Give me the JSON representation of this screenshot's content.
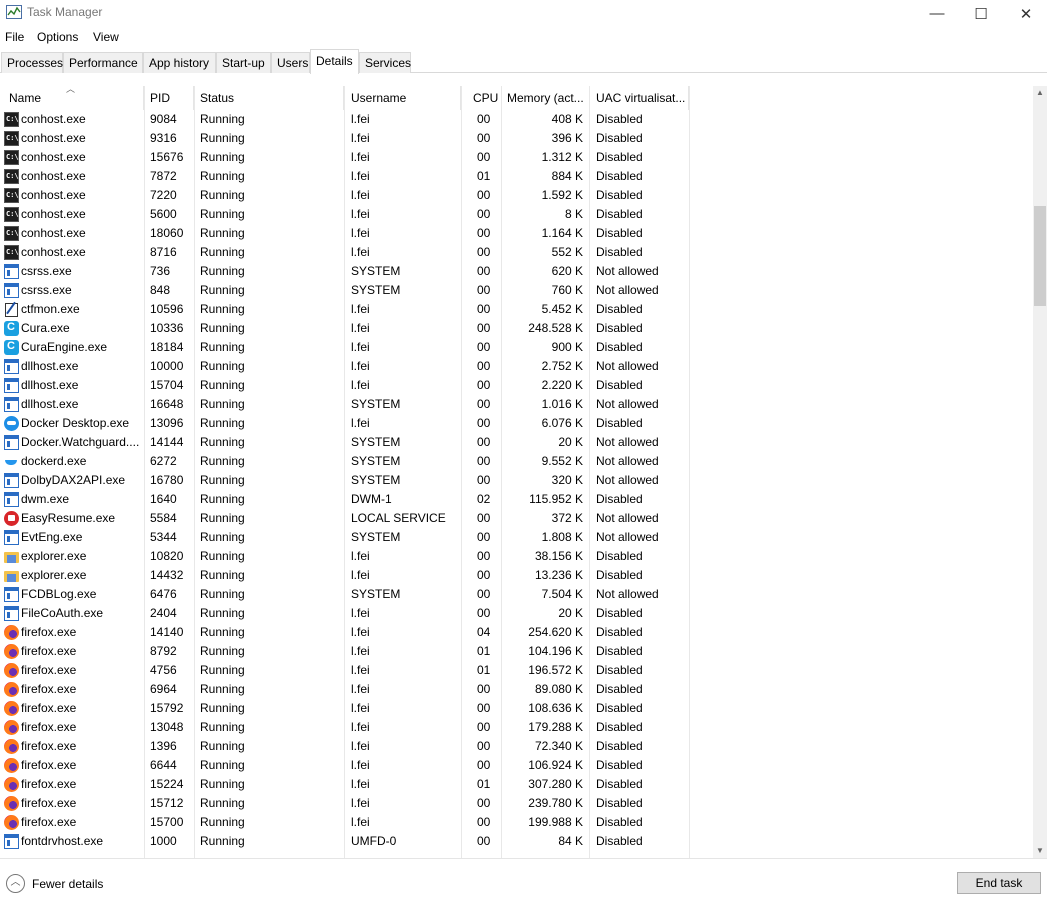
{
  "window": {
    "title": "Task Manager",
    "minimize_glyph": "—",
    "maximize_glyph": "☐",
    "close_glyph": "✕"
  },
  "menu": [
    "File",
    "Options",
    "View"
  ],
  "tabs": [
    {
      "label": "Processes",
      "active": false
    },
    {
      "label": "Performance",
      "active": false
    },
    {
      "label": "App history",
      "active": false
    },
    {
      "label": "Start-up",
      "active": false
    },
    {
      "label": "Users",
      "active": false
    },
    {
      "label": "Details",
      "active": true
    },
    {
      "label": "Services",
      "active": false
    }
  ],
  "columns": {
    "name": "Name",
    "pid": "PID",
    "status": "Status",
    "username": "Username",
    "cpu": "CPU",
    "memory": "Memory (act...",
    "uac": "UAC virtualisat..."
  },
  "rows": [
    {
      "name": "conhost.exe",
      "icon": "console-icon",
      "pid": "9084",
      "status": "Running",
      "user": "l.fei",
      "cpu": "00",
      "mem": "408 K",
      "uac": "Disabled"
    },
    {
      "name": "conhost.exe",
      "icon": "console-icon",
      "pid": "9316",
      "status": "Running",
      "user": "l.fei",
      "cpu": "00",
      "mem": "396 K",
      "uac": "Disabled"
    },
    {
      "name": "conhost.exe",
      "icon": "console-icon",
      "pid": "15676",
      "status": "Running",
      "user": "l.fei",
      "cpu": "00",
      "mem": "1.312 K",
      "uac": "Disabled"
    },
    {
      "name": "conhost.exe",
      "icon": "console-icon",
      "pid": "7872",
      "status": "Running",
      "user": "l.fei",
      "cpu": "01",
      "mem": "884 K",
      "uac": "Disabled"
    },
    {
      "name": "conhost.exe",
      "icon": "console-icon",
      "pid": "7220",
      "status": "Running",
      "user": "l.fei",
      "cpu": "00",
      "mem": "1.592 K",
      "uac": "Disabled"
    },
    {
      "name": "conhost.exe",
      "icon": "console-icon",
      "pid": "5600",
      "status": "Running",
      "user": "l.fei",
      "cpu": "00",
      "mem": "8 K",
      "uac": "Disabled"
    },
    {
      "name": "conhost.exe",
      "icon": "console-icon",
      "pid": "18060",
      "status": "Running",
      "user": "l.fei",
      "cpu": "00",
      "mem": "1.164 K",
      "uac": "Disabled"
    },
    {
      "name": "conhost.exe",
      "icon": "console-icon",
      "pid": "8716",
      "status": "Running",
      "user": "l.fei",
      "cpu": "00",
      "mem": "552 K",
      "uac": "Disabled"
    },
    {
      "name": "csrss.exe",
      "icon": "window-icon",
      "pid": "736",
      "status": "Running",
      "user": "SYSTEM",
      "cpu": "00",
      "mem": "620 K",
      "uac": "Not allowed"
    },
    {
      "name": "csrss.exe",
      "icon": "window-icon",
      "pid": "848",
      "status": "Running",
      "user": "SYSTEM",
      "cpu": "00",
      "mem": "760 K",
      "uac": "Not allowed"
    },
    {
      "name": "ctfmon.exe",
      "icon": "pen-icon",
      "pid": "10596",
      "status": "Running",
      "user": "l.fei",
      "cpu": "00",
      "mem": "5.452 K",
      "uac": "Disabled"
    },
    {
      "name": "Cura.exe",
      "icon": "cura-icon",
      "pid": "10336",
      "status": "Running",
      "user": "l.fei",
      "cpu": "00",
      "mem": "248.528 K",
      "uac": "Disabled"
    },
    {
      "name": "CuraEngine.exe",
      "icon": "cura-icon",
      "pid": "18184",
      "status": "Running",
      "user": "l.fei",
      "cpu": "00",
      "mem": "900 K",
      "uac": "Disabled"
    },
    {
      "name": "dllhost.exe",
      "icon": "window-icon",
      "pid": "10000",
      "status": "Running",
      "user": "l.fei",
      "cpu": "00",
      "mem": "2.752 K",
      "uac": "Not allowed"
    },
    {
      "name": "dllhost.exe",
      "icon": "window-icon",
      "pid": "15704",
      "status": "Running",
      "user": "l.fei",
      "cpu": "00",
      "mem": "2.220 K",
      "uac": "Disabled"
    },
    {
      "name": "dllhost.exe",
      "icon": "window-icon",
      "pid": "16648",
      "status": "Running",
      "user": "SYSTEM",
      "cpu": "00",
      "mem": "1.016 K",
      "uac": "Not allowed"
    },
    {
      "name": "Docker Desktop.exe",
      "icon": "docker-icon",
      "pid": "13096",
      "status": "Running",
      "user": "l.fei",
      "cpu": "00",
      "mem": "6.076 K",
      "uac": "Disabled"
    },
    {
      "name": "Docker.Watchguard....",
      "icon": "window-icon",
      "pid": "14144",
      "status": "Running",
      "user": "SYSTEM",
      "cpu": "00",
      "mem": "20 K",
      "uac": "Not allowed"
    },
    {
      "name": "dockerd.exe",
      "icon": "whale-icon",
      "pid": "6272",
      "status": "Running",
      "user": "SYSTEM",
      "cpu": "00",
      "mem": "9.552 K",
      "uac": "Not allowed"
    },
    {
      "name": "DolbyDAX2API.exe",
      "icon": "window-icon",
      "pid": "16780",
      "status": "Running",
      "user": "SYSTEM",
      "cpu": "00",
      "mem": "320 K",
      "uac": "Not allowed"
    },
    {
      "name": "dwm.exe",
      "icon": "window-icon",
      "pid": "1640",
      "status": "Running",
      "user": "DWM-1",
      "cpu": "02",
      "mem": "115.952 K",
      "uac": "Disabled"
    },
    {
      "name": "EasyResume.exe",
      "icon": "easyresume-icon",
      "pid": "5584",
      "status": "Running",
      "user": "LOCAL SERVICE",
      "cpu": "00",
      "mem": "372 K",
      "uac": "Not allowed"
    },
    {
      "name": "EvtEng.exe",
      "icon": "window-icon",
      "pid": "5344",
      "status": "Running",
      "user": "SYSTEM",
      "cpu": "00",
      "mem": "1.808 K",
      "uac": "Not allowed"
    },
    {
      "name": "explorer.exe",
      "icon": "folder-icon",
      "pid": "10820",
      "status": "Running",
      "user": "l.fei",
      "cpu": "00",
      "mem": "38.156 K",
      "uac": "Disabled"
    },
    {
      "name": "explorer.exe",
      "icon": "folder-icon",
      "pid": "14432",
      "status": "Running",
      "user": "l.fei",
      "cpu": "00",
      "mem": "13.236 K",
      "uac": "Disabled"
    },
    {
      "name": "FCDBLog.exe",
      "icon": "window-icon",
      "pid": "6476",
      "status": "Running",
      "user": "SYSTEM",
      "cpu": "00",
      "mem": "7.504 K",
      "uac": "Not allowed"
    },
    {
      "name": "FileCoAuth.exe",
      "icon": "window-icon",
      "pid": "2404",
      "status": "Running",
      "user": "l.fei",
      "cpu": "00",
      "mem": "20 K",
      "uac": "Disabled"
    },
    {
      "name": "firefox.exe",
      "icon": "firefox-icon",
      "pid": "14140",
      "status": "Running",
      "user": "l.fei",
      "cpu": "04",
      "mem": "254.620 K",
      "uac": "Disabled"
    },
    {
      "name": "firefox.exe",
      "icon": "firefox-icon",
      "pid": "8792",
      "status": "Running",
      "user": "l.fei",
      "cpu": "01",
      "mem": "104.196 K",
      "uac": "Disabled"
    },
    {
      "name": "firefox.exe",
      "icon": "firefox-icon",
      "pid": "4756",
      "status": "Running",
      "user": "l.fei",
      "cpu": "01",
      "mem": "196.572 K",
      "uac": "Disabled"
    },
    {
      "name": "firefox.exe",
      "icon": "firefox-icon",
      "pid": "6964",
      "status": "Running",
      "user": "l.fei",
      "cpu": "00",
      "mem": "89.080 K",
      "uac": "Disabled"
    },
    {
      "name": "firefox.exe",
      "icon": "firefox-icon",
      "pid": "15792",
      "status": "Running",
      "user": "l.fei",
      "cpu": "00",
      "mem": "108.636 K",
      "uac": "Disabled"
    },
    {
      "name": "firefox.exe",
      "icon": "firefox-icon",
      "pid": "13048",
      "status": "Running",
      "user": "l.fei",
      "cpu": "00",
      "mem": "179.288 K",
      "uac": "Disabled"
    },
    {
      "name": "firefox.exe",
      "icon": "firefox-icon",
      "pid": "1396",
      "status": "Running",
      "user": "l.fei",
      "cpu": "00",
      "mem": "72.340 K",
      "uac": "Disabled"
    },
    {
      "name": "firefox.exe",
      "icon": "firefox-icon",
      "pid": "6644",
      "status": "Running",
      "user": "l.fei",
      "cpu": "00",
      "mem": "106.924 K",
      "uac": "Disabled"
    },
    {
      "name": "firefox.exe",
      "icon": "firefox-icon",
      "pid": "15224",
      "status": "Running",
      "user": "l.fei",
      "cpu": "01",
      "mem": "307.280 K",
      "uac": "Disabled"
    },
    {
      "name": "firefox.exe",
      "icon": "firefox-icon",
      "pid": "15712",
      "status": "Running",
      "user": "l.fei",
      "cpu": "00",
      "mem": "239.780 K",
      "uac": "Disabled"
    },
    {
      "name": "firefox.exe",
      "icon": "firefox-icon",
      "pid": "15700",
      "status": "Running",
      "user": "l.fei",
      "cpu": "00",
      "mem": "199.988 K",
      "uac": "Disabled"
    },
    {
      "name": "fontdrvhost.exe",
      "icon": "window-icon",
      "pid": "1000",
      "status": "Running",
      "user": "UMFD-0",
      "cpu": "00",
      "mem": "84 K",
      "uac": "Disabled"
    }
  ],
  "footer": {
    "fewer_details": "Fewer details",
    "end_task": "End task"
  }
}
